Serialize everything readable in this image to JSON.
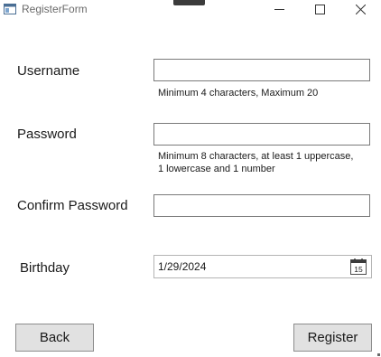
{
  "window": {
    "title": "RegisterForm",
    "icons": {
      "app": "window-icon",
      "minimize": "minimize-icon",
      "maximize": "maximize-icon",
      "close": "close-icon"
    }
  },
  "form": {
    "username": {
      "label": "Username",
      "value": "",
      "hint": "Minimum 4 characters, Maximum 20"
    },
    "password": {
      "label": "Password",
      "value": "",
      "hint_line1": "Minimum 8 characters, at least 1 uppercase,",
      "hint_line2": "1 lowercase and 1 number"
    },
    "confirm_password": {
      "label": "Confirm Password",
      "value": ""
    },
    "birthday": {
      "label": "Birthday",
      "value": "1/29/2024",
      "calendar_icon": "calendar-icon",
      "calendar_day": "15"
    }
  },
  "buttons": {
    "back": "Back",
    "register": "Register"
  }
}
